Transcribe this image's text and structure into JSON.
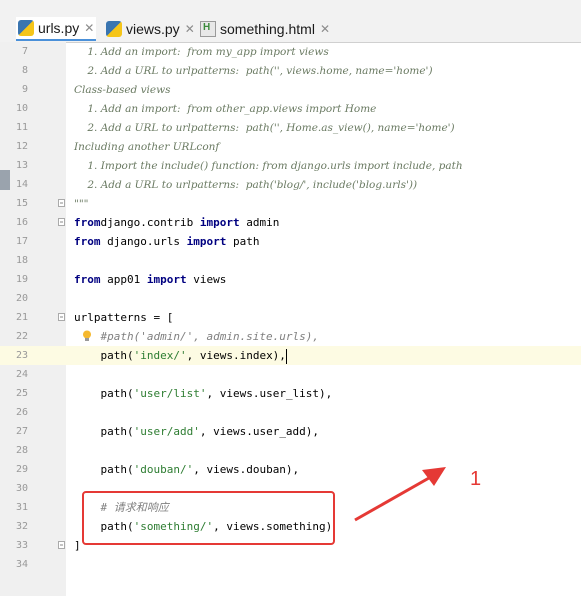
{
  "tabs": [
    {
      "label": "urls.py",
      "icon": "python-file-icon",
      "active": true
    },
    {
      "label": "views.py",
      "icon": "python-file-icon",
      "active": false
    },
    {
      "label": "something.html",
      "icon": "html-file-icon",
      "active": false
    }
  ],
  "editor": {
    "current_line": 23,
    "lines": [
      {
        "n": "7",
        "t": "doc",
        "segs": [
          [
            "doc",
            "    1. Add an import:  from my_app import views"
          ]
        ]
      },
      {
        "n": "8",
        "t": "doc",
        "segs": [
          [
            "doc",
            "    2. Add a URL to urlpatterns:  path('', views.home, name='home')"
          ]
        ]
      },
      {
        "n": "9",
        "t": "doc",
        "segs": [
          [
            "doc",
            "Class-based views"
          ]
        ]
      },
      {
        "n": "10",
        "t": "doc",
        "segs": [
          [
            "doc",
            "    1. Add an import:  from other_app.views import Home"
          ]
        ]
      },
      {
        "n": "11",
        "t": "doc",
        "segs": [
          [
            "doc",
            "    2. Add a URL to urlpatterns:  path('', Home.as_view(), name='home')"
          ]
        ]
      },
      {
        "n": "12",
        "t": "doc",
        "segs": [
          [
            "doc",
            "Including another URLconf"
          ]
        ]
      },
      {
        "n": "13",
        "t": "doc",
        "segs": [
          [
            "doc",
            "    1. Import the include() function: from django.urls import include, path"
          ]
        ]
      },
      {
        "n": "14",
        "t": "doc",
        "segs": [
          [
            "doc",
            "    2. Add a URL to urlpatterns:  path('blog/', include('blog.urls'))"
          ]
        ]
      },
      {
        "n": "15",
        "t": "doc",
        "segs": [
          [
            "doc",
            "\"\"\""
          ]
        ]
      },
      {
        "n": "16",
        "t": "code",
        "segs": [
          [
            "kw",
            "from"
          ],
          [
            "",
            "django.contrib "
          ],
          [
            "kw",
            "import"
          ],
          [
            "",
            " admin"
          ]
        ]
      },
      {
        "n": "17",
        "t": "code",
        "segs": [
          [
            "kw",
            "from"
          ],
          [
            "",
            " django.urls "
          ],
          [
            "kw",
            "import"
          ],
          [
            "",
            " path"
          ]
        ]
      },
      {
        "n": "18",
        "t": "code",
        "segs": []
      },
      {
        "n": "19",
        "t": "code",
        "segs": [
          [
            "kw",
            "from"
          ],
          [
            "",
            " app01 "
          ],
          [
            "kw",
            "import"
          ],
          [
            "",
            " views"
          ]
        ]
      },
      {
        "n": "20",
        "t": "code",
        "segs": []
      },
      {
        "n": "21",
        "t": "code",
        "segs": [
          [
            "",
            "urlpatterns = ["
          ]
        ]
      },
      {
        "n": "22",
        "t": "code",
        "segs": [
          [
            "cmt",
            "    #path('admin/', admin.site.urls),"
          ]
        ]
      },
      {
        "n": "23",
        "t": "code",
        "segs": [
          [
            "",
            "    path("
          ],
          [
            "str",
            "'index/'"
          ],
          [
            "",
            ", views.index),"
          ]
        ]
      },
      {
        "n": "24",
        "t": "code",
        "segs": []
      },
      {
        "n": "25",
        "t": "code",
        "segs": [
          [
            "",
            "    path("
          ],
          [
            "str",
            "'user/list'"
          ],
          [
            "",
            ", views.user_list),"
          ]
        ]
      },
      {
        "n": "26",
        "t": "code",
        "segs": []
      },
      {
        "n": "27",
        "t": "code",
        "segs": [
          [
            "",
            "    path("
          ],
          [
            "str",
            "'user/add'"
          ],
          [
            "",
            ", views.user_add),"
          ]
        ]
      },
      {
        "n": "28",
        "t": "code",
        "segs": []
      },
      {
        "n": "29",
        "t": "code",
        "segs": [
          [
            "",
            "    path("
          ],
          [
            "str",
            "'douban/'"
          ],
          [
            "",
            ", views.douban),"
          ]
        ]
      },
      {
        "n": "30",
        "t": "code",
        "segs": []
      },
      {
        "n": "31",
        "t": "code",
        "segs": [
          [
            "cmt",
            "    # 请求和响应"
          ]
        ]
      },
      {
        "n": "32",
        "t": "code",
        "segs": [
          [
            "",
            "    path("
          ],
          [
            "str",
            "'something/'"
          ],
          [
            "",
            ", views.something)"
          ]
        ]
      },
      {
        "n": "33",
        "t": "code",
        "segs": [
          [
            "",
            "]"
          ]
        ]
      },
      {
        "n": "34",
        "t": "code",
        "segs": []
      }
    ]
  },
  "annotation": {
    "label": "1",
    "color": "#e53935"
  }
}
